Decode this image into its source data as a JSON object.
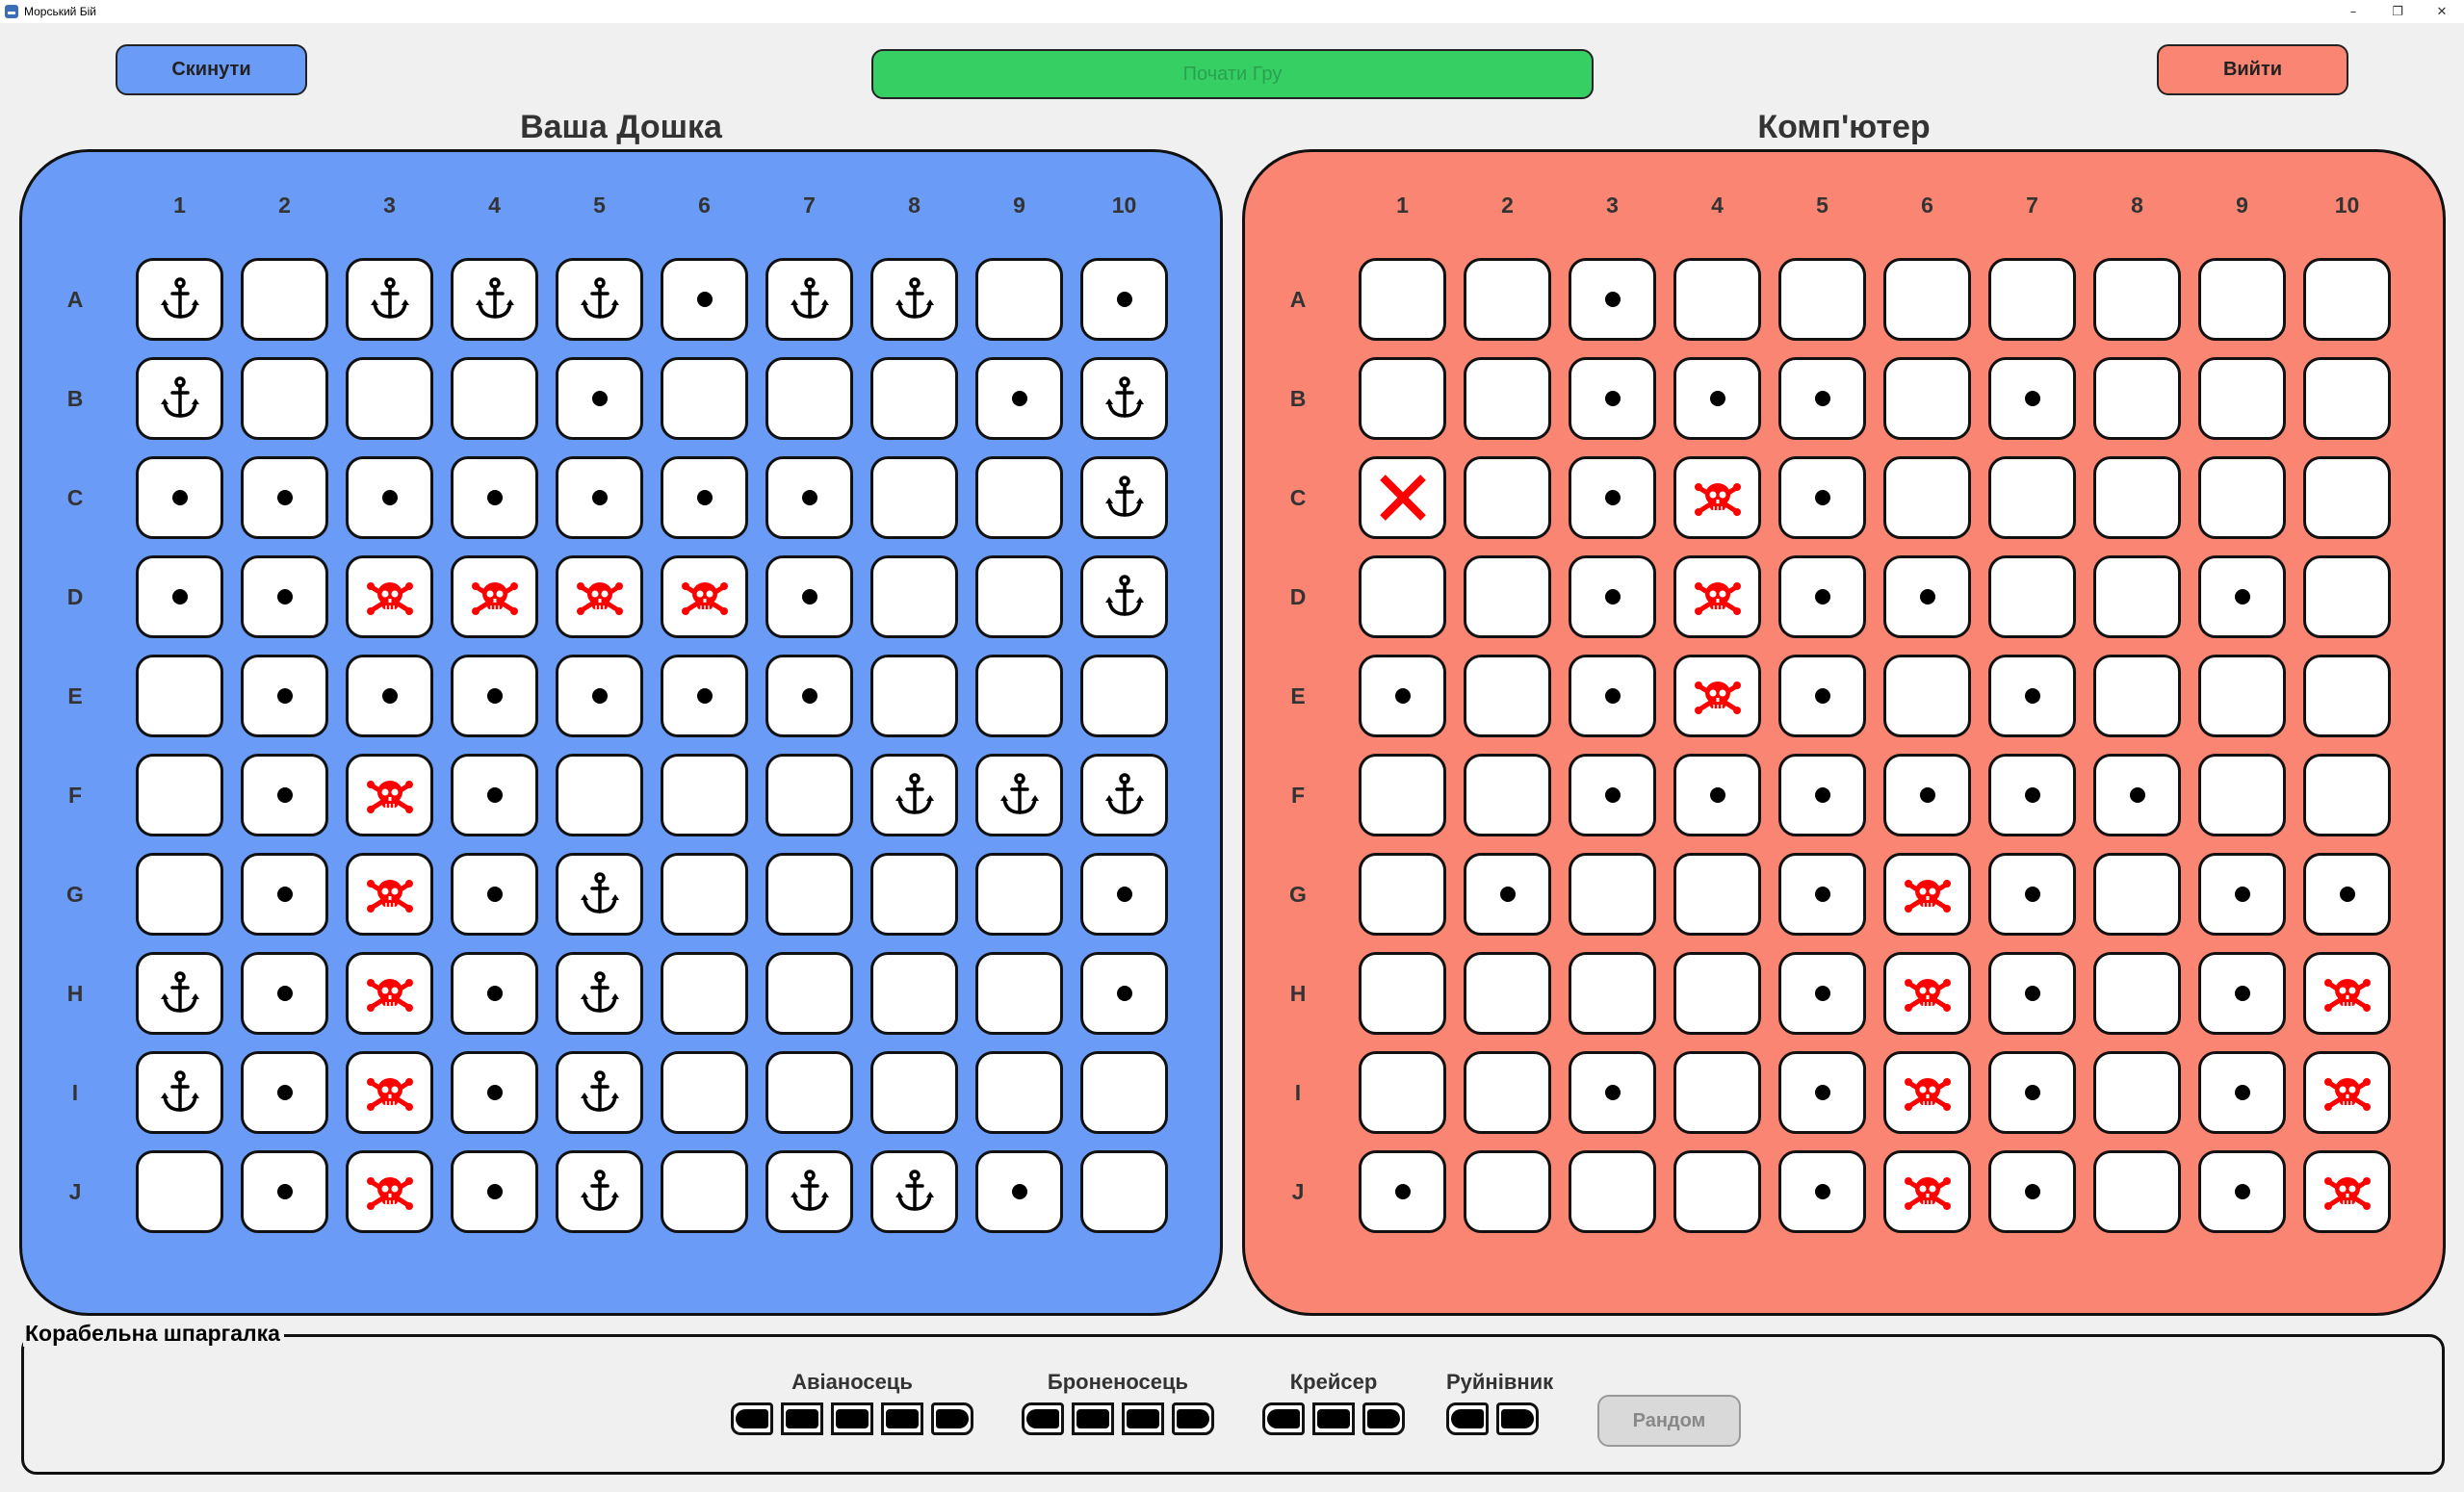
{
  "window": {
    "title": "Морський Бій",
    "controls": [
      "–",
      "❐",
      "✕"
    ]
  },
  "toolbar": {
    "reset_label": "Скинути",
    "start_label": "Почати Гру",
    "exit_label": "Вийти"
  },
  "colors": {
    "player_board": "#6a9bf7",
    "computer_board": "#fa8572",
    "start_button": "#35cf64",
    "reset_button": "#6a9bf7",
    "exit_button": "#fa8572",
    "hit_mark": "#ff0000"
  },
  "player": {
    "title": "Ваша Дошка",
    "columns": [
      "1",
      "2",
      "3",
      "4",
      "5",
      "6",
      "7",
      "8",
      "9",
      "10"
    ],
    "rows": [
      "A",
      "B",
      "C",
      "D",
      "E",
      "F",
      "G",
      "H",
      "I",
      "J"
    ],
    "grid": [
      [
        "ship",
        "empty",
        "ship",
        "ship",
        "ship",
        "miss",
        "ship",
        "ship",
        "empty",
        "miss"
      ],
      [
        "ship",
        "empty",
        "empty",
        "empty",
        "miss",
        "empty",
        "empty",
        "empty",
        "miss",
        "ship"
      ],
      [
        "miss",
        "miss",
        "miss",
        "miss",
        "miss",
        "miss",
        "miss",
        "empty",
        "empty",
        "ship"
      ],
      [
        "miss",
        "miss",
        "hit",
        "hit",
        "hit",
        "hit",
        "miss",
        "empty",
        "empty",
        "ship"
      ],
      [
        "empty",
        "miss",
        "miss",
        "miss",
        "miss",
        "miss",
        "miss",
        "empty",
        "empty",
        "empty"
      ],
      [
        "empty",
        "miss",
        "hit",
        "miss",
        "empty",
        "empty",
        "empty",
        "ship",
        "ship",
        "ship"
      ],
      [
        "empty",
        "miss",
        "hit",
        "miss",
        "ship",
        "empty",
        "empty",
        "empty",
        "empty",
        "miss"
      ],
      [
        "ship",
        "miss",
        "hit",
        "miss",
        "ship",
        "empty",
        "empty",
        "empty",
        "empty",
        "miss"
      ],
      [
        "ship",
        "miss",
        "hit",
        "miss",
        "ship",
        "empty",
        "empty",
        "empty",
        "empty",
        "empty"
      ],
      [
        "empty",
        "miss",
        "hit",
        "miss",
        "ship",
        "empty",
        "ship",
        "ship",
        "miss",
        "empty"
      ]
    ]
  },
  "computer": {
    "title": "Комп'ютер",
    "columns": [
      "1",
      "2",
      "3",
      "4",
      "5",
      "6",
      "7",
      "8",
      "9",
      "10"
    ],
    "rows": [
      "A",
      "B",
      "C",
      "D",
      "E",
      "F",
      "G",
      "H",
      "I",
      "J"
    ],
    "grid": [
      [
        "empty",
        "empty",
        "miss",
        "empty",
        "empty",
        "empty",
        "empty",
        "empty",
        "empty",
        "empty"
      ],
      [
        "empty",
        "empty",
        "miss",
        "miss",
        "miss",
        "empty",
        "miss",
        "empty",
        "empty",
        "empty"
      ],
      [
        "cross",
        "empty",
        "miss",
        "hit",
        "miss",
        "empty",
        "empty",
        "empty",
        "empty",
        "empty"
      ],
      [
        "empty",
        "empty",
        "miss",
        "hit",
        "miss",
        "miss",
        "empty",
        "empty",
        "miss",
        "empty"
      ],
      [
        "miss",
        "empty",
        "miss",
        "hit",
        "miss",
        "empty",
        "miss",
        "empty",
        "empty",
        "empty"
      ],
      [
        "empty",
        "empty",
        "miss",
        "miss",
        "miss",
        "miss",
        "miss",
        "miss",
        "empty",
        "empty"
      ],
      [
        "empty",
        "miss",
        "empty",
        "empty",
        "miss",
        "hit",
        "miss",
        "empty",
        "miss",
        "miss"
      ],
      [
        "empty",
        "empty",
        "empty",
        "empty",
        "miss",
        "hit",
        "miss",
        "empty",
        "miss",
        "hit"
      ],
      [
        "empty",
        "empty",
        "miss",
        "empty",
        "miss",
        "hit",
        "miss",
        "empty",
        "miss",
        "hit"
      ],
      [
        "miss",
        "empty",
        "empty",
        "empty",
        "miss",
        "hit",
        "miss",
        "empty",
        "miss",
        "hit"
      ]
    ]
  },
  "cheatsheet": {
    "legend": "Корабельна шпаргалка",
    "ships": [
      {
        "name": "Авіаносець",
        "size": 5
      },
      {
        "name": "Броненосець",
        "size": 4
      },
      {
        "name": "Крейсер",
        "size": 3
      },
      {
        "name": "Руйнівник",
        "size": 2
      }
    ],
    "random_label": "Рандом"
  }
}
